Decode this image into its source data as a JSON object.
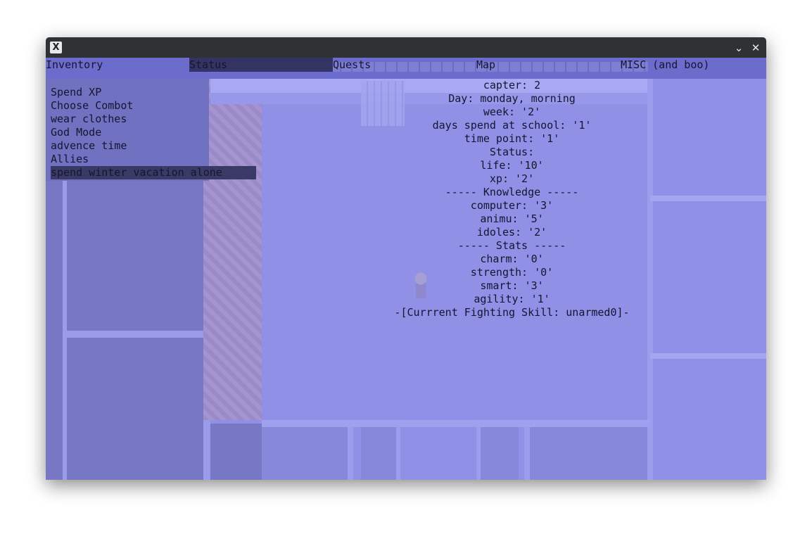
{
  "window": {
    "close_glyph": "✕",
    "minimize_glyph": "⌄",
    "app_icon": "X-app-icon"
  },
  "tabs": [
    {
      "label": "Inventory",
      "active": false
    },
    {
      "label": "Status",
      "active": true
    },
    {
      "label": "Quests",
      "active": false
    },
    {
      "label": "Map",
      "active": false
    },
    {
      "label": "MISC (and boo)",
      "active": false
    }
  ],
  "actions": [
    {
      "label": "Spend XP",
      "selected": false
    },
    {
      "label": "Choose Combot",
      "selected": false
    },
    {
      "label": "wear clothes",
      "selected": false
    },
    {
      "label": "God Mode",
      "selected": false
    },
    {
      "label": "advence time",
      "selected": false
    },
    {
      "label": "Allies",
      "selected": false
    },
    {
      "label": "spend winter vacation alone",
      "selected": true
    }
  ],
  "status": {
    "capter": "capter: 2",
    "day": "Day: monday, morning",
    "week": "week: '2'",
    "days_school": "days spend at school: '1'",
    "time_point": "time point: '1'",
    "status_header": "Status:",
    "life": "life: '10'",
    "xp": "xp: '2'",
    "knowledge_header": "----- Knowledge -----",
    "computer": "computer: '3'",
    "animu": "animu: '5'",
    "idoles": "idoles: '2'",
    "stats_header": "----- Stats -----",
    "charm": "charm: '0'",
    "strength": "strength: '0'",
    "smart": "smart: '3'",
    "agility": "agility: '1'",
    "fighting_skill": "-[Currrent Fighting Skill: unarmed0]-"
  },
  "colors": {
    "background": "#8f90e6",
    "menu_bar": "#6c6ccc",
    "selection": "#343464",
    "text": "#151530"
  }
}
